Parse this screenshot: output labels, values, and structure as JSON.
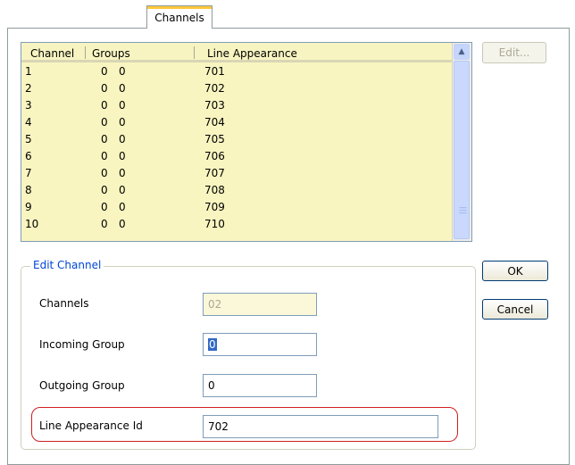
{
  "tab": {
    "label": "Channels"
  },
  "list": {
    "headers": {
      "channel": "Channel",
      "groups": "Groups",
      "line_appearance": "Line Appearance"
    },
    "rows": [
      {
        "channel": "1",
        "incoming": "0",
        "outgoing": "0",
        "line_appearance": "701"
      },
      {
        "channel": "2",
        "incoming": "0",
        "outgoing": "0",
        "line_appearance": "702"
      },
      {
        "channel": "3",
        "incoming": "0",
        "outgoing": "0",
        "line_appearance": "703"
      },
      {
        "channel": "4",
        "incoming": "0",
        "outgoing": "0",
        "line_appearance": "704"
      },
      {
        "channel": "5",
        "incoming": "0",
        "outgoing": "0",
        "line_appearance": "705"
      },
      {
        "channel": "6",
        "incoming": "0",
        "outgoing": "0",
        "line_appearance": "706"
      },
      {
        "channel": "7",
        "incoming": "0",
        "outgoing": "0",
        "line_appearance": "707"
      },
      {
        "channel": "8",
        "incoming": "0",
        "outgoing": "0",
        "line_appearance": "708"
      },
      {
        "channel": "9",
        "incoming": "0",
        "outgoing": "0",
        "line_appearance": "709"
      },
      {
        "channel": "10",
        "incoming": "0",
        "outgoing": "0",
        "line_appearance": "710"
      }
    ],
    "scroll_up_icon": "chevron-up-icon",
    "scroll_grip_icon": "grip-icon"
  },
  "buttons": {
    "edit": "Edit...",
    "ok": "OK",
    "cancel": "Cancel"
  },
  "edit_channel": {
    "title": "Edit Channel",
    "channels_label": "Channels",
    "channels_value": "02",
    "incoming_label": "Incoming Group",
    "incoming_value": "0",
    "outgoing_label": "Outgoing Group",
    "outgoing_value": "0",
    "line_appearance_label": "Line Appearance Id",
    "line_appearance_value": "702"
  },
  "colors": {
    "list_background": "#f8f5c0",
    "highlight_outline": "#ce1f1f",
    "group_title": "#0046d5",
    "tab_accent": "#ffc83c"
  }
}
